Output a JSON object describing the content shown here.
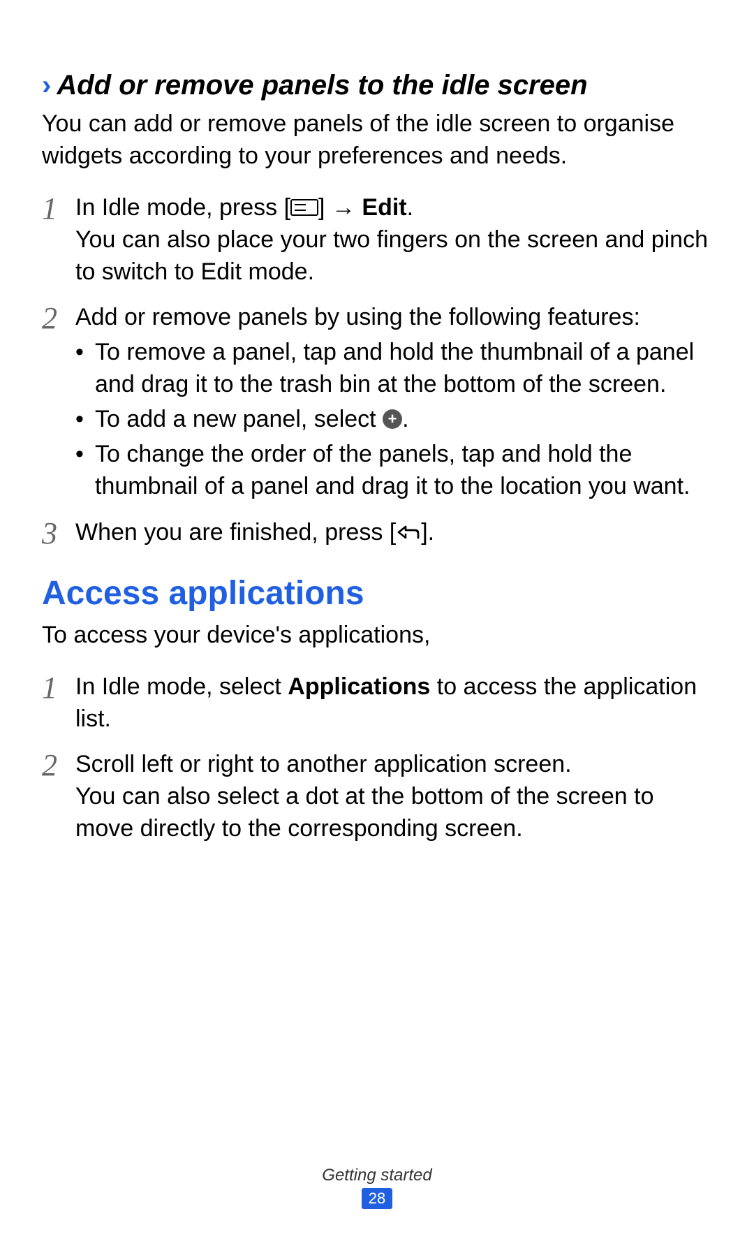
{
  "section1": {
    "heading": "Add or remove panels to the idle screen",
    "desc": "You can add or remove panels of the idle screen to organise widgets according to your preferences and needs.",
    "step1": {
      "line1_pre": "In Idle mode, press [",
      "line1_mid": "] → ",
      "line1_bold": "Edit",
      "line1_post": ".",
      "line2": "You can also place your two fingers on the screen and pinch to switch to Edit mode."
    },
    "step2": {
      "intro": "Add or remove panels by using the following features:",
      "bullet1": "To remove a panel, tap and hold the thumbnail of a panel and drag it to the trash bin at the bottom of the screen.",
      "bullet2_pre": "To add a new panel, select ",
      "bullet2_post": ".",
      "bullet3": "To change the order of the panels, tap and hold the thumbnail of a panel and drag it to the location you want."
    },
    "step3": {
      "pre": "When you are finished, press [",
      "post": "]."
    }
  },
  "section2": {
    "heading": "Access applications",
    "desc": "To access your device's applications,",
    "step1": {
      "pre": "In Idle mode, select ",
      "bold": "Applications",
      "post": " to access the application list."
    },
    "step2": {
      "line1": "Scroll left or right to another application screen.",
      "line2": "You can also select a dot at the bottom of the screen to move directly to the corresponding screen."
    }
  },
  "footer": {
    "label": "Getting started",
    "page": "28"
  },
  "nums": {
    "one": "1",
    "two": "2",
    "three": "3"
  }
}
